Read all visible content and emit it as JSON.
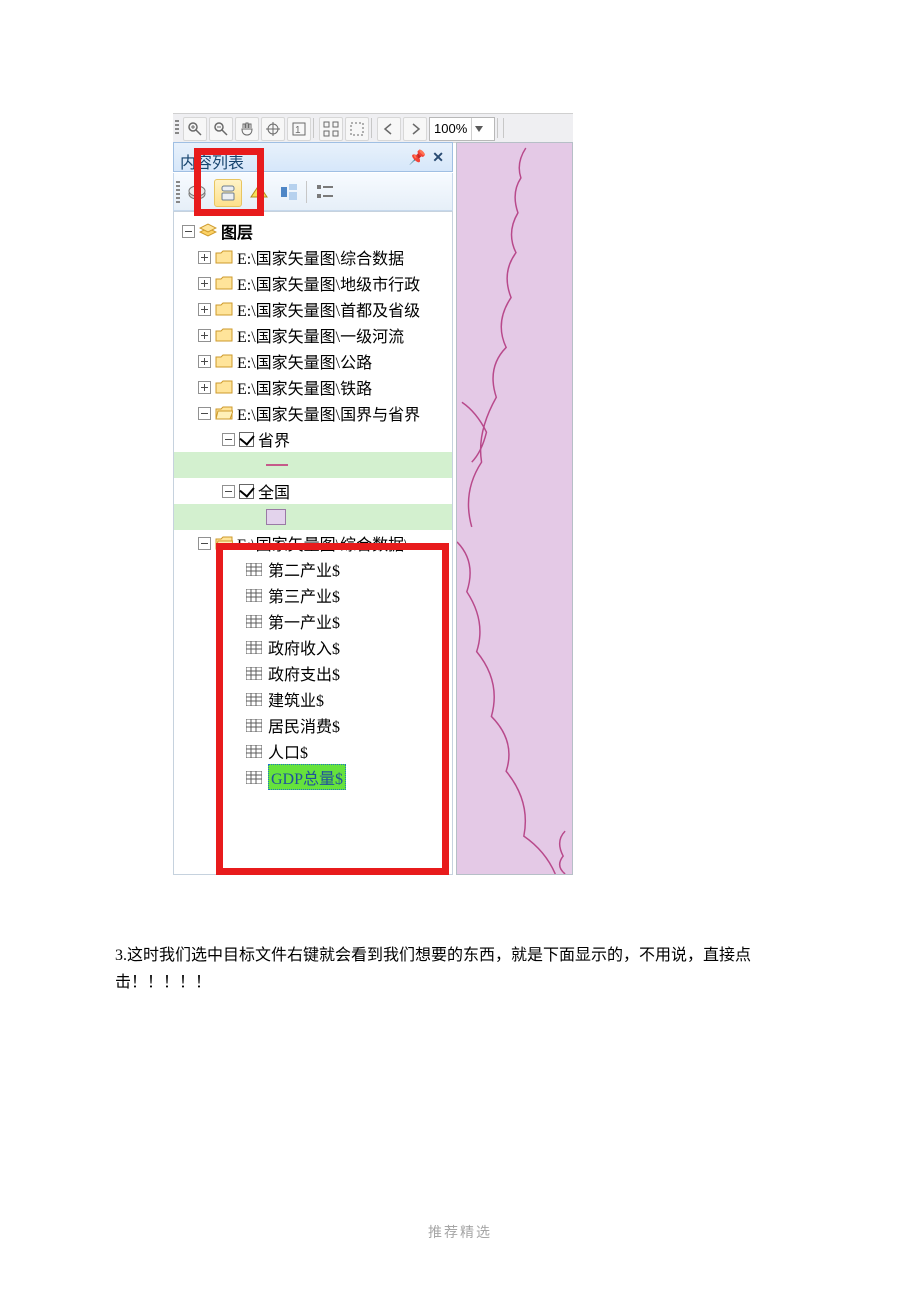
{
  "toolbar": {
    "zoom": "100%"
  },
  "panel": {
    "title": "内容列表",
    "pin": "⬛",
    "close": "✕"
  },
  "tree": {
    "root": "图层",
    "datasets": [
      "E:\\国家矢量图\\综合数据",
      "E:\\国家矢量图\\地级市行政",
      "E:\\国家矢量图\\首都及省级",
      "E:\\国家矢量图\\一级河流",
      "E:\\国家矢量图\\公路",
      "E:\\国家矢量图\\铁路"
    ],
    "open_dataset": "E:\\国家矢量图\\国界与省界",
    "layer1": "省界",
    "layer2": "全国",
    "tables_dataset": "E:\\国家矢量图\\综合数据\\",
    "tables": [
      "第二产业$",
      "第三产业$",
      "第一产业$",
      "政府收入$",
      "政府支出$",
      "建筑业$",
      "居民消费$",
      "人口$"
    ],
    "selected_table": "GDP总量$"
  },
  "paragraph": "3.这时我们选中目标文件右键就会看到我们想要的东西，就是下面显示的，不用说，直接点击！！！！！",
  "footer": "推荐精选"
}
